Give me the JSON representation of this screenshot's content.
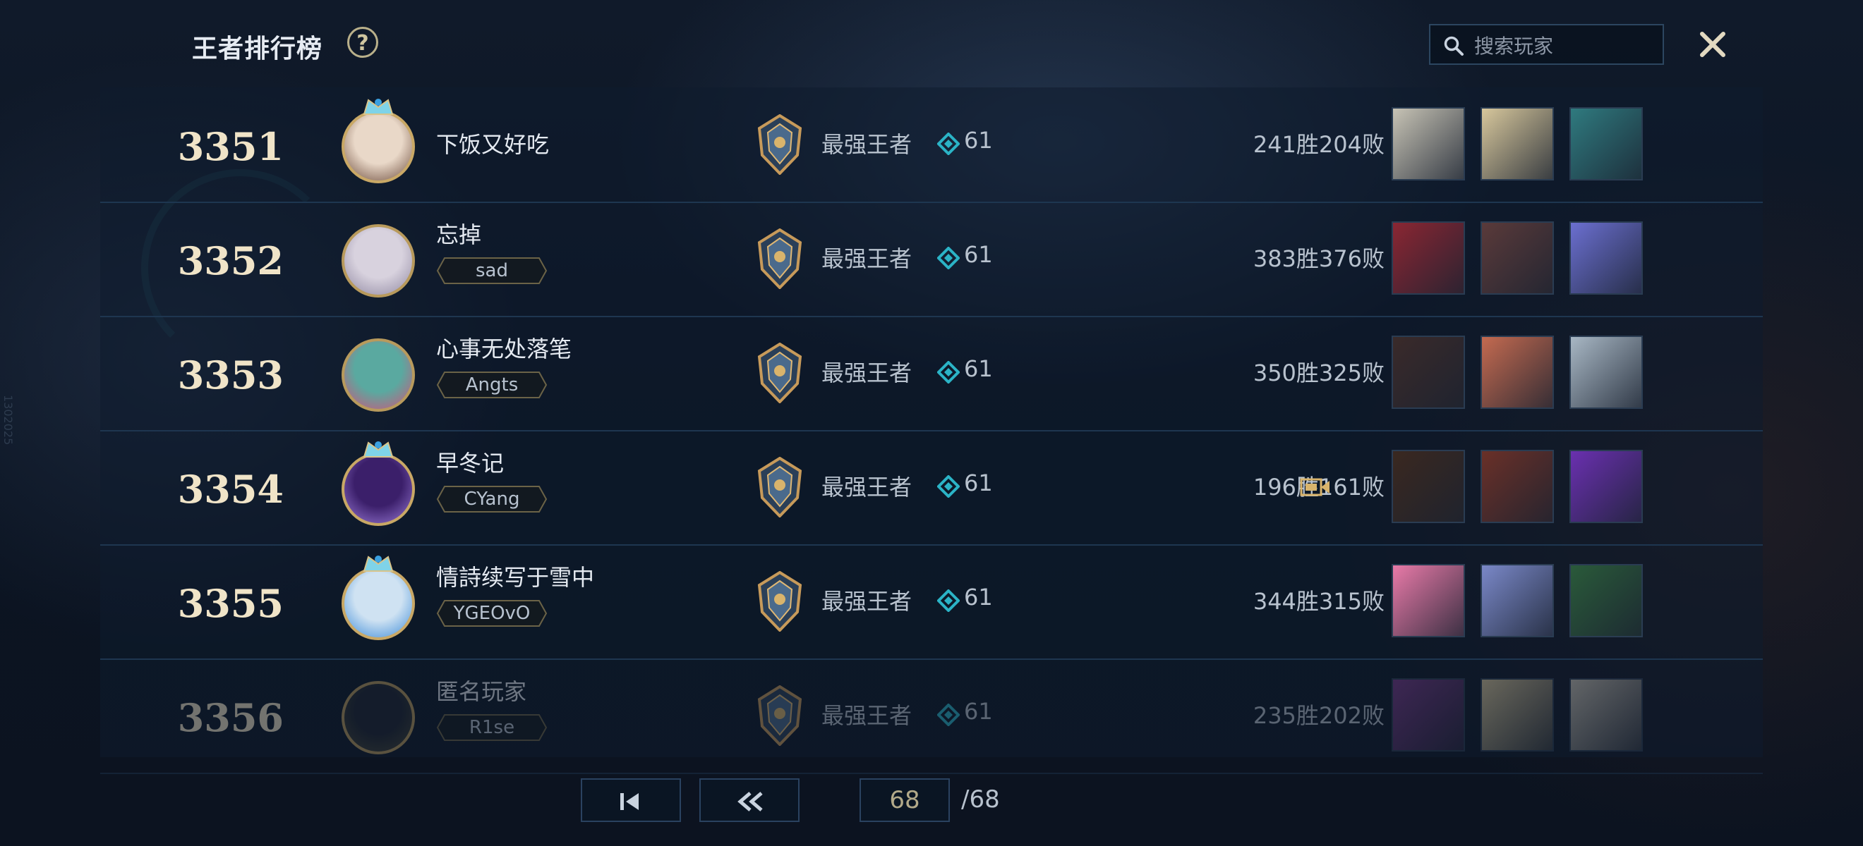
{
  "header": {
    "title": "王者排行榜",
    "help_label": "?",
    "search_placeholder": "搜索玩家",
    "close_label": "✕"
  },
  "side_id": "1302025",
  "colors": {
    "gold": "#c9a865",
    "cyan": "#2bb3c6",
    "background": "#0b1422"
  },
  "players": [
    {
      "rank": "3351",
      "name": "下饭又好吃",
      "tag": "",
      "tier": "最强王者",
      "lp": "61",
      "record": "241胜204败",
      "video": false,
      "avatar_color": "#e9d8c8",
      "avatar_accent": "#6b4a3a",
      "crowned": true,
      "champions": [
        {
          "name": "champ-1",
          "color": "#c7c3b5"
        },
        {
          "name": "champ-2",
          "color": "#d7c79c"
        },
        {
          "name": "champ-3",
          "color": "#2f7a7f"
        }
      ]
    },
    {
      "rank": "3352",
      "name": "忘掉",
      "tag": "sad",
      "tier": "最强王者",
      "lp": "61",
      "record": "383胜376败",
      "video": false,
      "avatar_color": "#d8d2de",
      "avatar_accent": "#8e86a0",
      "crowned": false,
      "champions": [
        {
          "name": "champ-1",
          "color": "#8a2633"
        },
        {
          "name": "champ-2",
          "color": "#5a3a3a"
        },
        {
          "name": "champ-3",
          "color": "#6b6fd0"
        }
      ]
    },
    {
      "rank": "3353",
      "name": "心事无处落笔",
      "tag": "Angts",
      "tier": "最强王者",
      "lp": "61",
      "record": "350胜325败",
      "video": false,
      "avatar_color": "#5aa9a0",
      "avatar_accent": "#d5507a",
      "crowned": false,
      "champions": [
        {
          "name": "champ-1",
          "color": "#3a2a2a"
        },
        {
          "name": "champ-2",
          "color": "#c46a50"
        },
        {
          "name": "champ-3",
          "color": "#a8b7c4"
        }
      ]
    },
    {
      "rank": "3354",
      "name": "早冬记",
      "tag": "CYang",
      "tier": "最强王者",
      "lp": "61",
      "record": "196胜161败",
      "video": true,
      "avatar_color": "#3b1f6a",
      "avatar_accent": "#9a7ad8",
      "crowned": true,
      "champions": [
        {
          "name": "champ-1",
          "color": "#3a2820"
        },
        {
          "name": "champ-2",
          "color": "#6a3028"
        },
        {
          "name": "champ-3",
          "color": "#6a30b0"
        }
      ]
    },
    {
      "rank": "3355",
      "name": "情詩续写于雪中",
      "tag": "YGEOvO",
      "tier": "最强王者",
      "lp": "61",
      "record": "344胜315败",
      "video": false,
      "avatar_color": "#cfe2f2",
      "avatar_accent": "#3a8ad8",
      "crowned": true,
      "champions": [
        {
          "name": "champ-1",
          "color": "#e87aa8"
        },
        {
          "name": "champ-2",
          "color": "#7a88c8"
        },
        {
          "name": "champ-3",
          "color": "#2a5a3a"
        }
      ]
    },
    {
      "rank": "3356",
      "name": "匿名玩家",
      "tag": "R1se",
      "tier": "最强王者",
      "lp": "61",
      "record": "235胜202败",
      "video": false,
      "avatar_color": "#1e2430",
      "avatar_accent": "#4a4a3a",
      "crowned": false,
      "champions": [
        {
          "name": "champ-1",
          "color": "#7a3a8a"
        },
        {
          "name": "champ-2",
          "color": "#d7c79c"
        },
        {
          "name": "champ-3",
          "color": "#c7c3b5"
        }
      ]
    }
  ],
  "pagination": {
    "current_page": "68",
    "total_pages": "/68"
  }
}
